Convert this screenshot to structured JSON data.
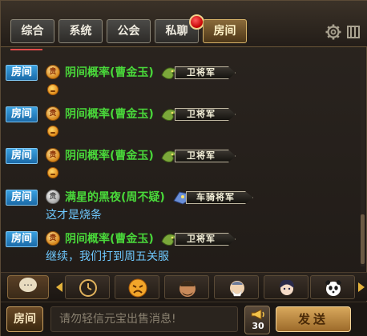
{
  "tabs": [
    {
      "label": "综合"
    },
    {
      "label": "系统"
    },
    {
      "label": "公会"
    },
    {
      "label": "私聊"
    },
    {
      "label": "房间"
    }
  ],
  "active_tab": "房间",
  "messages": [
    {
      "channel": "房间",
      "sender": "阴间概率(曹金玉)",
      "rank": "卫将军",
      "vip": "gold",
      "text": "",
      "emote": "smiley-emote"
    },
    {
      "channel": "房间",
      "sender": "阴间概率(曹金玉)",
      "rank": "卫将军",
      "vip": "gold",
      "text": "",
      "emote": "smiley-emote"
    },
    {
      "channel": "房间",
      "sender": "阴间概率(曹金玉)",
      "rank": "卫将军",
      "vip": "gold",
      "text": "",
      "emote": "smiley-emote"
    },
    {
      "channel": "房间",
      "sender": "满星的黑夜(周不疑)",
      "rank": "车骑将军",
      "vip": "silver",
      "text": "这才是烧条"
    },
    {
      "channel": "房间",
      "sender": "阴间概率(曹金玉)",
      "rank": "卫将军",
      "vip": "gold",
      "text": "继续，我们打到周五关服"
    }
  ],
  "emoji_strip": {
    "items": [
      "clock-emoji",
      "sad-face-emoji",
      "warrior-emoji",
      "old-sage-emoji",
      "maiden-emoji",
      "panda-emoji"
    ]
  },
  "input": {
    "channel_label": "房间",
    "placeholder": "请勿轻信元宝出售消息!",
    "horn_count": "30",
    "send_label": "发送"
  },
  "colors": {
    "room_badge": "#2b86cc",
    "sender_name": "#49d83a",
    "message_text": "#6fc9ff",
    "accent_gold": "#d8a85c"
  }
}
